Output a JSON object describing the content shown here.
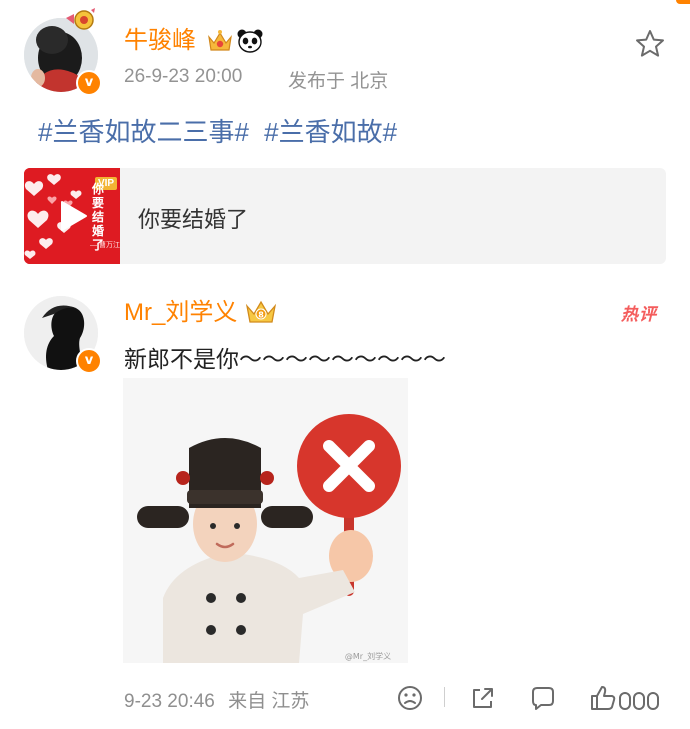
{
  "post": {
    "username": "牛骏峰",
    "timestamp": "26-9-23 20:00",
    "location_label": "发布于 北京",
    "hashtags": [
      "#兰香如故二三事#",
      "#兰香如故#"
    ],
    "music_card": {
      "title": "你要结婚了",
      "cover_title": "你要结婚了",
      "cover_badge": "VIP",
      "cover_artist": "— 曹万江"
    }
  },
  "comment": {
    "username": "Mr_刘学义",
    "hot_badge": "热评",
    "text": "新郎不是你～～～～～～～～～",
    "sticker_watermark": "@Mr_刘学义",
    "time": "9-23 20:46",
    "source": "来自 江苏"
  },
  "colors": {
    "accent_orange": "#ff8200",
    "link_blue": "#4a6ea9",
    "hot_red": "#f45c5c",
    "meta_gray": "#939393"
  },
  "icons": {
    "star": "star-icon",
    "verified": "verified-badge-icon",
    "crown": "crown-icon",
    "panda": "panda-icon",
    "play": "play-icon",
    "face": "face-reaction-icon",
    "share": "share-icon",
    "comment": "comment-icon",
    "like": "like-icon"
  }
}
